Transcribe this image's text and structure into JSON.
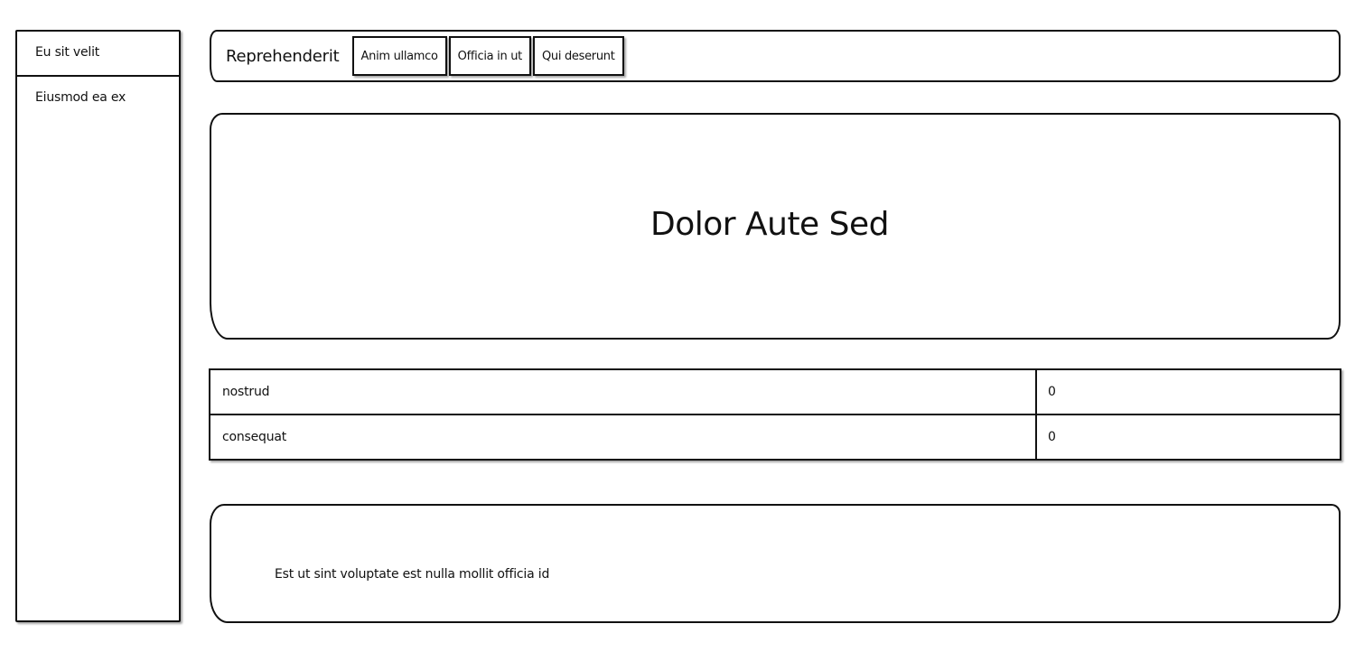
{
  "sidebar": {
    "items": [
      {
        "label": "Eu sit velit"
      },
      {
        "label": "Eiusmod ea ex"
      }
    ]
  },
  "header": {
    "title": "Reprehenderit",
    "tabs": [
      {
        "label": "Anim ullamco"
      },
      {
        "label": "Officia in ut"
      },
      {
        "label": "Qui deserunt"
      }
    ]
  },
  "hero": {
    "title": "Dolor Aute Sed"
  },
  "table": {
    "rows": [
      {
        "label": "nostrud",
        "value": "0"
      },
      {
        "label": "consequat",
        "value": "0"
      }
    ]
  },
  "footer": {
    "text": "Est ut sint voluptate est nulla mollit officia id"
  }
}
